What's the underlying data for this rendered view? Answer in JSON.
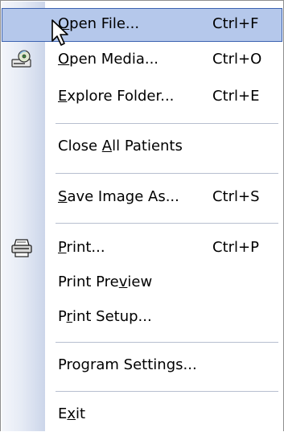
{
  "menu": {
    "items": [
      {
        "id": "open-file",
        "label": "Open File...",
        "mnemonic": "O",
        "shortcut": "Ctrl+F",
        "highlighted": true,
        "icon": "cursor-arrow"
      },
      {
        "id": "open-media",
        "label": "Open Media...",
        "mnemonic": "O",
        "shortcut": "Ctrl+O",
        "icon": "media-disc-icon"
      },
      {
        "id": "explore-folder",
        "label": "Explore Folder...",
        "mnemonic": "E",
        "shortcut": "Ctrl+E"
      },
      {
        "id": "close-all-patients",
        "label": "Close All Patients",
        "mnemonic": "A",
        "shortcut": ""
      },
      {
        "id": "save-image-as",
        "label": "Save Image As...",
        "mnemonic": "S",
        "shortcut": "Ctrl+S"
      },
      {
        "id": "print",
        "label": "Print...",
        "mnemonic": "P",
        "shortcut": "Ctrl+P",
        "icon": "printer-icon"
      },
      {
        "id": "print-preview",
        "label": "Print Preview",
        "mnemonic": "v",
        "shortcut": ""
      },
      {
        "id": "print-setup",
        "label": "Print Setup...",
        "mnemonic": "r",
        "shortcut": ""
      },
      {
        "id": "program-settings",
        "label": "Program Settings...",
        "mnemonic": "",
        "shortcut": ""
      },
      {
        "id": "exit",
        "label": "Exit",
        "mnemonic": "x",
        "shortcut": ""
      }
    ]
  },
  "colors": {
    "highlight_fill": "#b5c8eb",
    "highlight_border": "#3b62b0",
    "gutter_light": "#f4f6fb",
    "gutter_dark": "#ccd6ea",
    "separator": "#b7bfcf"
  }
}
